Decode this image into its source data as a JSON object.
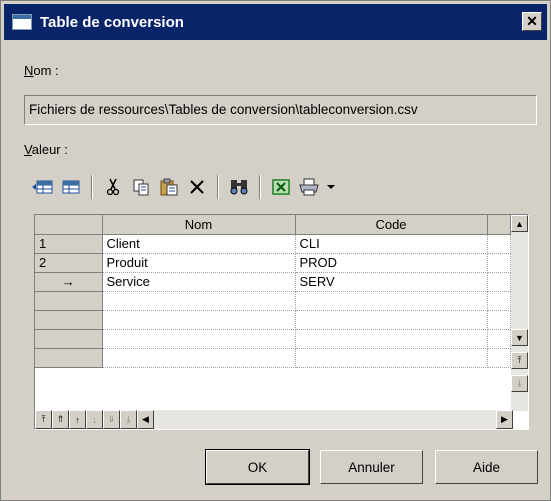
{
  "window": {
    "title": "Table de conversion",
    "close_glyph": "✕"
  },
  "name": {
    "label_prefix": "N",
    "label_rest": "om :",
    "value": "Fichiers de ressources\\Tables de conversion\\tableconversion.csv"
  },
  "value_section": {
    "label_prefix": "V",
    "label_rest": "aleur :"
  },
  "toolbar": {
    "icons": [
      "insert-row-icon",
      "add-row-icon",
      "cut-icon",
      "copy-icon",
      "paste-icon",
      "delete-icon",
      "find-icon",
      "excel-export-icon",
      "print-icon",
      "dropdown-arrow-icon"
    ]
  },
  "grid": {
    "columns": [
      "Nom",
      "Code"
    ],
    "rows": [
      {
        "header": "1",
        "nom": "Client",
        "code": "CLI"
      },
      {
        "header": "2",
        "nom": "Produit",
        "code": "PROD"
      },
      {
        "header": "→",
        "nom": "Service",
        "code": "SERV"
      },
      {
        "header": "",
        "nom": "",
        "code": ""
      },
      {
        "header": "",
        "nom": "",
        "code": ""
      },
      {
        "header": "",
        "nom": "",
        "code": ""
      },
      {
        "header": "",
        "nom": "",
        "code": ""
      }
    ]
  },
  "buttons": {
    "ok": "OK",
    "cancel": "Annuler",
    "help": "Aide"
  }
}
